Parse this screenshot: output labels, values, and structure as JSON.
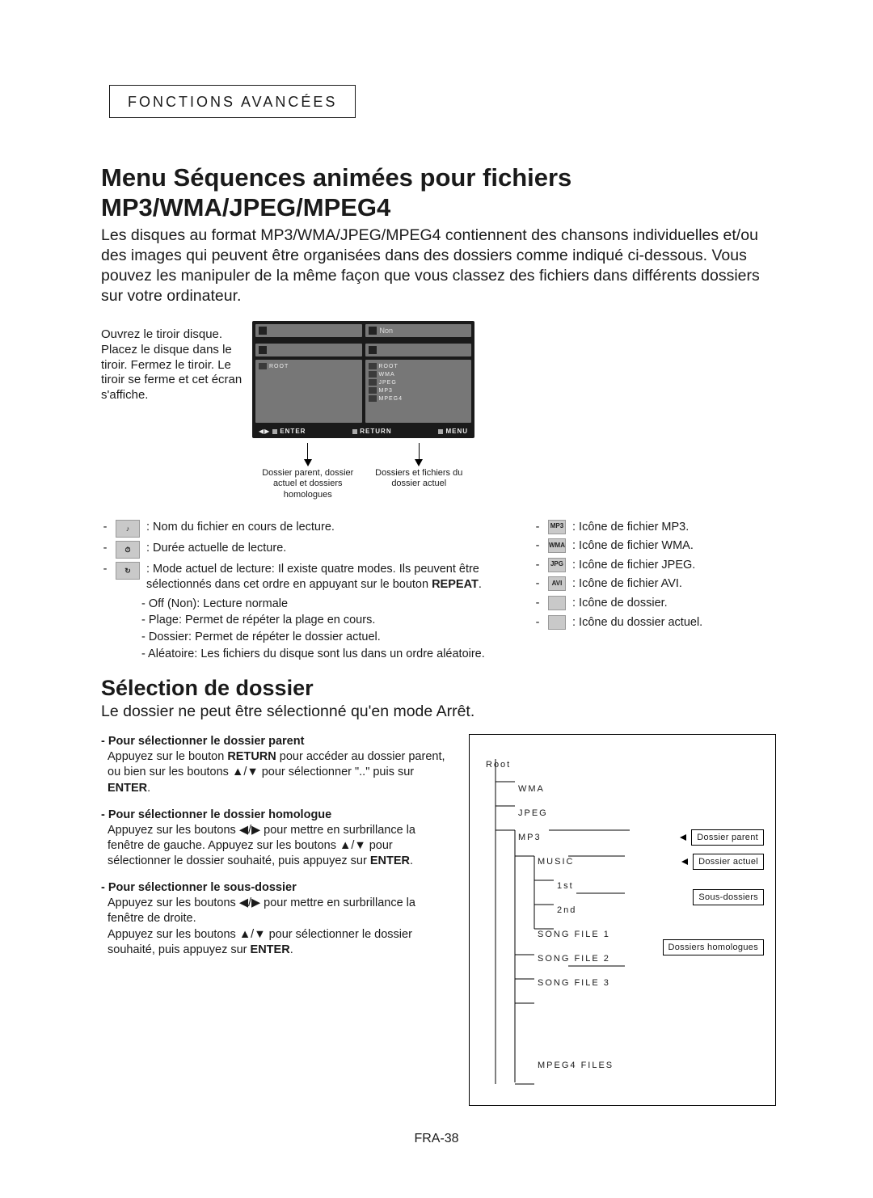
{
  "header": {
    "section": "FONCTIONS AVANCÉES"
  },
  "title": "Menu Séquences animées pour fichiers MP3/WMA/JPEG/MPEG4",
  "intro": "Les disques au format MP3/WMA/JPEG/MPEG4 contiennent des chansons individuelles et/ou des images qui peuvent être organisées dans des dossiers comme indiqué ci-dessous. Vous pouvez les manipuler de la même façon que vous classez des fichiers dans différents dossiers sur votre ordinateur.",
  "step_text": "Ouvrez le tiroir disque. Placez le disque dans le tiroir. Fermez le tiroir. Le tiroir se ferme et cet écran s'affiche.",
  "osd": {
    "top_left": "",
    "top_right": "Non",
    "left_items": [
      "ROOT"
    ],
    "right_items": [
      "ROOT",
      "WMA",
      "JPEG",
      "MP3",
      "MPEG4"
    ],
    "footer": [
      "ENTER",
      "RETURN",
      "MENU"
    ]
  },
  "osd_callouts": {
    "left": "Dossier parent, dossier actuel et dossiers homologues",
    "right": "Dossiers et fichiers du dossier actuel"
  },
  "legend_left": {
    "name": ": Nom du fichier en cours de lecture.",
    "duration": ": Durée actuelle de lecture.",
    "mode_intro": ": Mode actuel de lecture: Il existe quatre modes. Ils peuvent être sélectionnés dans cet ordre en appuyant sur le bouton ",
    "repeat_label": "REPEAT",
    "mode_off": "- Off (Non): Lecture normale",
    "mode_track": "- Plage: Permet de répéter la plage en cours.",
    "mode_folder": "- Dossier: Permet de répéter le dossier actuel.",
    "mode_random": "- Aléatoire: Les fichiers du disque sont lus dans un ordre aléatoire."
  },
  "legend_right": {
    "mp3": ": Icône de fichier MP3.",
    "wma": ": Icône de fichier WMA.",
    "jpeg": ": Icône de fichier JPEG.",
    "avi": ": Icône de fichier AVI.",
    "folder": ": Icône de dossier.",
    "folder_cur": ": Icône du dossier actuel."
  },
  "section2_title": "Sélection de dossier",
  "section2_lead": "Le dossier ne peut être sélectionné qu'en mode Arrêt.",
  "sel": {
    "parent_ttl": "- Pour sélectionner le dossier parent",
    "parent_body_a": "Appuyez sur le bouton ",
    "parent_btn": "RETURN",
    "parent_body_b": " pour accéder au dossier parent, ou bien sur les boutons ▲/▼ pour sélectionner \"..\" puis sur ",
    "parent_enter": "ENTER",
    "parent_body_c": ".",
    "peer_ttl": "- Pour sélectionner le dossier homologue",
    "peer_body": "Appuyez sur les boutons ◀/▶ pour mettre en surbrillance la fenêtre de gauche. Appuyez sur les boutons ▲/▼ pour sélectionner le dossier souhaité, puis appuyez sur ",
    "peer_enter": "ENTER",
    "peer_body_end": ".",
    "sub_ttl": "- Pour sélectionner le sous-dossier",
    "sub_body_a": "Appuyez sur les boutons ◀/▶ pour mettre en surbrillance la fenêtre de droite.",
    "sub_body_b": "Appuyez sur les boutons ▲/▼ pour sélectionner le dossier souhaité, puis appuyez sur ",
    "sub_enter": "ENTER",
    "sub_body_end": "."
  },
  "tree": {
    "root": "Root",
    "wma": "WMA",
    "jpeg": "JPEG",
    "mp3": "MP3",
    "music": "MUSIC",
    "first": "1st",
    "second": "2nd",
    "song1": "SONG FILE 1",
    "song2": "SONG FILE 2",
    "song3": "SONG FILE 3",
    "mpeg4": "MPEG4 FILES",
    "box_parent": "Dossier parent",
    "box_current": "Dossier actuel",
    "box_sub": "Sous-dossiers",
    "box_peer": "Dossiers homologues"
  },
  "page_number": "FRA-38"
}
